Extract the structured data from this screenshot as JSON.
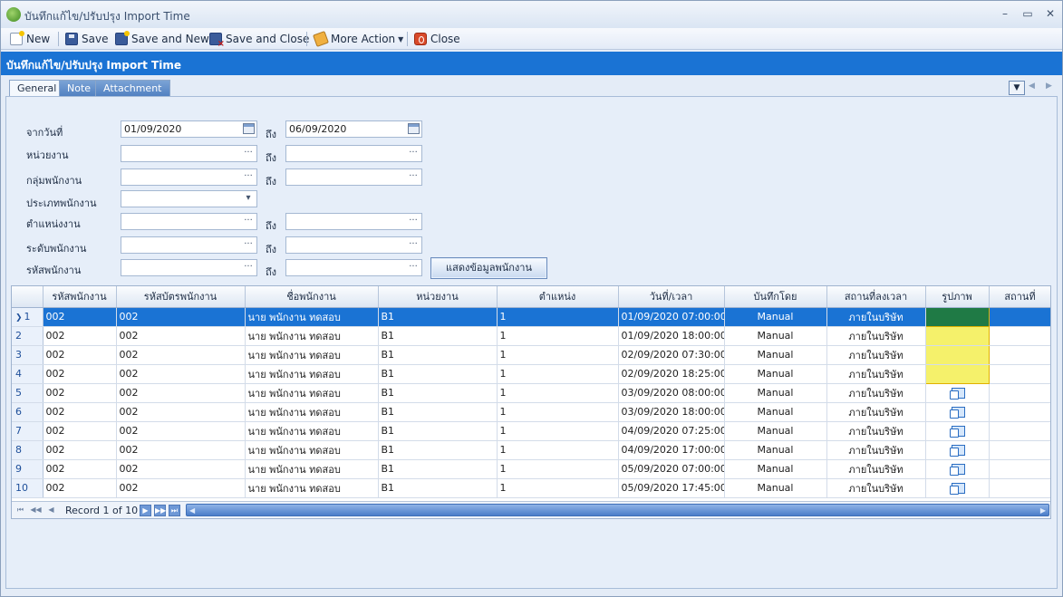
{
  "window": {
    "title": "บันทึกแก้ไข/ปรับปรุง Import Time"
  },
  "toolbar": {
    "new": "New",
    "save": "Save",
    "save_and_new": "Save and New",
    "save_and_close": "Save and Close",
    "more_action": "More Action",
    "close": "Close"
  },
  "header": {
    "title": "บันทึกแก้ไข/ปรับปรุง Import Time"
  },
  "tabs": [
    {
      "label": "General"
    },
    {
      "label": "Note"
    },
    {
      "label": "Attachment"
    }
  ],
  "form": {
    "to": "ถึง",
    "from_date_label": "จากวันที่",
    "from_date": "01/09/2020",
    "to_date": "06/09/2020",
    "department_label": "หน่วยงาน",
    "employee_group_label": "กลุ่มพนักงาน",
    "employee_type_label": "ประเภทพนักงาน",
    "position_label": "ตำแหน่งงาน",
    "employee_level_label": "ระดับพนักงาน",
    "employee_code_label": "รหัสพนักงาน",
    "show_button": "แสดงข้อมูลพนักงาน",
    "ellipsis": "···",
    "dropdown_caret": "▾"
  },
  "grid": {
    "columns": [
      "",
      "รหัสพนักงาน",
      "รหัสบัตรพนักงาน",
      "ชื่อพนักงาน",
      "หน่วยงาน",
      "ตำแหน่ง",
      "วันที่/เวลา",
      "บันทึกโดย",
      "สถานที่ลงเวลา",
      "รูปภาพ",
      "สถานที่"
    ],
    "rows": [
      {
        "num": "1",
        "emp_code": "002",
        "card_code": "002",
        "name": "นาย พนักงาน ทดสอบ",
        "dept": "B1",
        "position": "1",
        "datetime": "01/09/2020 07:00:00",
        "recorded_by": "Manual",
        "location": "ภายในบริษัท",
        "photo": "green"
      },
      {
        "num": "2",
        "emp_code": "002",
        "card_code": "002",
        "name": "นาย พนักงาน ทดสอบ",
        "dept": "B1",
        "position": "1",
        "datetime": "01/09/2020 18:00:00",
        "recorded_by": "Manual",
        "location": "ภายในบริษัท",
        "photo": "yellow"
      },
      {
        "num": "3",
        "emp_code": "002",
        "card_code": "002",
        "name": "นาย พนักงาน ทดสอบ",
        "dept": "B1",
        "position": "1",
        "datetime": "02/09/2020 07:30:00",
        "recorded_by": "Manual",
        "location": "ภายในบริษัท",
        "photo": "yellow"
      },
      {
        "num": "4",
        "emp_code": "002",
        "card_code": "002",
        "name": "นาย พนักงาน ทดสอบ",
        "dept": "B1",
        "position": "1",
        "datetime": "02/09/2020 18:25:00",
        "recorded_by": "Manual",
        "location": "ภายในบริษัท",
        "photo": "yellow"
      },
      {
        "num": "5",
        "emp_code": "002",
        "card_code": "002",
        "name": "นาย พนักงาน ทดสอบ",
        "dept": "B1",
        "position": "1",
        "datetime": "03/09/2020 08:00:00",
        "recorded_by": "Manual",
        "location": "ภายในบริษัท",
        "photo": "icon"
      },
      {
        "num": "6",
        "emp_code": "002",
        "card_code": "002",
        "name": "นาย พนักงาน ทดสอบ",
        "dept": "B1",
        "position": "1",
        "datetime": "03/09/2020 18:00:00",
        "recorded_by": "Manual",
        "location": "ภายในบริษัท",
        "photo": "icon"
      },
      {
        "num": "7",
        "emp_code": "002",
        "card_code": "002",
        "name": "นาย พนักงาน ทดสอบ",
        "dept": "B1",
        "position": "1",
        "datetime": "04/09/2020 07:25:00",
        "recorded_by": "Manual",
        "location": "ภายในบริษัท",
        "photo": "icon"
      },
      {
        "num": "8",
        "emp_code": "002",
        "card_code": "002",
        "name": "นาย พนักงาน ทดสอบ",
        "dept": "B1",
        "position": "1",
        "datetime": "04/09/2020 17:00:00",
        "recorded_by": "Manual",
        "location": "ภายในบริษัท",
        "photo": "icon"
      },
      {
        "num": "9",
        "emp_code": "002",
        "card_code": "002",
        "name": "นาย พนักงาน ทดสอบ",
        "dept": "B1",
        "position": "1",
        "datetime": "05/09/2020 07:00:00",
        "recorded_by": "Manual",
        "location": "ภายในบริษัท",
        "photo": "icon"
      },
      {
        "num": "10",
        "emp_code": "002",
        "card_code": "002",
        "name": "นาย พนักงาน ทดสอบ",
        "dept": "B1",
        "position": "1",
        "datetime": "05/09/2020 17:45:00",
        "recorded_by": "Manual",
        "location": "ภายในบริษัท",
        "photo": "icon"
      }
    ],
    "selected_row": 1
  },
  "pager": {
    "record_text": "Record 1 of 10"
  },
  "colors": {
    "accent": "#1a73d4",
    "photo_highlight": "#f5f16b",
    "photo_selected": "#1f7a45"
  }
}
